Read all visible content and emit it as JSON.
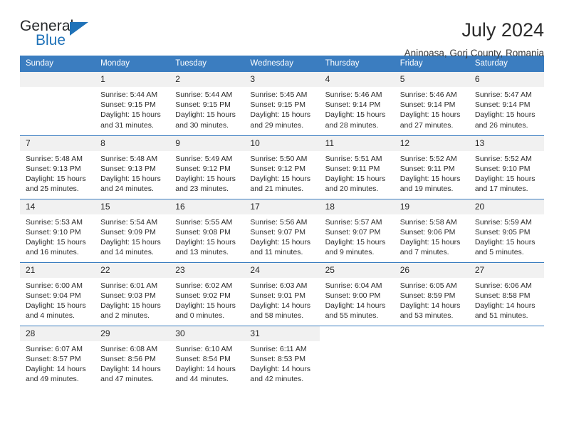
{
  "brand": {
    "word1": "General",
    "word2": "Blue",
    "accent": "#1f72b8",
    "triangle_icon": "triangle-icon"
  },
  "header": {
    "title": "July 2024",
    "subtitle": "Aninoasa, Gorj County, Romania"
  },
  "theme": {
    "header_bg": "#3b7dc0",
    "daynum_bg": "#f1f1f1",
    "text": "#2c2c2c",
    "grid_line": "#3b7dc0"
  },
  "calendar": {
    "weekday_headers": [
      "Sunday",
      "Monday",
      "Tuesday",
      "Wednesday",
      "Thursday",
      "Friday",
      "Saturday"
    ],
    "labels": {
      "sunrise": "Sunrise:",
      "sunset": "Sunset:",
      "daylight": "Daylight:"
    },
    "weeks": [
      [
        {
          "day": "",
          "blank": true,
          "sunrise": "",
          "sunset": "",
          "daylight_1": "",
          "daylight_2": ""
        },
        {
          "day": "1",
          "sunrise": "Sunrise: 5:44 AM",
          "sunset": "Sunset: 9:15 PM",
          "daylight_1": "Daylight: 15 hours",
          "daylight_2": "and 31 minutes."
        },
        {
          "day": "2",
          "sunrise": "Sunrise: 5:44 AM",
          "sunset": "Sunset: 9:15 PM",
          "daylight_1": "Daylight: 15 hours",
          "daylight_2": "and 30 minutes."
        },
        {
          "day": "3",
          "sunrise": "Sunrise: 5:45 AM",
          "sunset": "Sunset: 9:15 PM",
          "daylight_1": "Daylight: 15 hours",
          "daylight_2": "and 29 minutes."
        },
        {
          "day": "4",
          "sunrise": "Sunrise: 5:46 AM",
          "sunset": "Sunset: 9:14 PM",
          "daylight_1": "Daylight: 15 hours",
          "daylight_2": "and 28 minutes."
        },
        {
          "day": "5",
          "sunrise": "Sunrise: 5:46 AM",
          "sunset": "Sunset: 9:14 PM",
          "daylight_1": "Daylight: 15 hours",
          "daylight_2": "and 27 minutes."
        },
        {
          "day": "6",
          "sunrise": "Sunrise: 5:47 AM",
          "sunset": "Sunset: 9:14 PM",
          "daylight_1": "Daylight: 15 hours",
          "daylight_2": "and 26 minutes."
        }
      ],
      [
        {
          "day": "7",
          "sunrise": "Sunrise: 5:48 AM",
          "sunset": "Sunset: 9:13 PM",
          "daylight_1": "Daylight: 15 hours",
          "daylight_2": "and 25 minutes."
        },
        {
          "day": "8",
          "sunrise": "Sunrise: 5:48 AM",
          "sunset": "Sunset: 9:13 PM",
          "daylight_1": "Daylight: 15 hours",
          "daylight_2": "and 24 minutes."
        },
        {
          "day": "9",
          "sunrise": "Sunrise: 5:49 AM",
          "sunset": "Sunset: 9:12 PM",
          "daylight_1": "Daylight: 15 hours",
          "daylight_2": "and 23 minutes."
        },
        {
          "day": "10",
          "sunrise": "Sunrise: 5:50 AM",
          "sunset": "Sunset: 9:12 PM",
          "daylight_1": "Daylight: 15 hours",
          "daylight_2": "and 21 minutes."
        },
        {
          "day": "11",
          "sunrise": "Sunrise: 5:51 AM",
          "sunset": "Sunset: 9:11 PM",
          "daylight_1": "Daylight: 15 hours",
          "daylight_2": "and 20 minutes."
        },
        {
          "day": "12",
          "sunrise": "Sunrise: 5:52 AM",
          "sunset": "Sunset: 9:11 PM",
          "daylight_1": "Daylight: 15 hours",
          "daylight_2": "and 19 minutes."
        },
        {
          "day": "13",
          "sunrise": "Sunrise: 5:52 AM",
          "sunset": "Sunset: 9:10 PM",
          "daylight_1": "Daylight: 15 hours",
          "daylight_2": "and 17 minutes."
        }
      ],
      [
        {
          "day": "14",
          "sunrise": "Sunrise: 5:53 AM",
          "sunset": "Sunset: 9:10 PM",
          "daylight_1": "Daylight: 15 hours",
          "daylight_2": "and 16 minutes."
        },
        {
          "day": "15",
          "sunrise": "Sunrise: 5:54 AM",
          "sunset": "Sunset: 9:09 PM",
          "daylight_1": "Daylight: 15 hours",
          "daylight_2": "and 14 minutes."
        },
        {
          "day": "16",
          "sunrise": "Sunrise: 5:55 AM",
          "sunset": "Sunset: 9:08 PM",
          "daylight_1": "Daylight: 15 hours",
          "daylight_2": "and 13 minutes."
        },
        {
          "day": "17",
          "sunrise": "Sunrise: 5:56 AM",
          "sunset": "Sunset: 9:07 PM",
          "daylight_1": "Daylight: 15 hours",
          "daylight_2": "and 11 minutes."
        },
        {
          "day": "18",
          "sunrise": "Sunrise: 5:57 AM",
          "sunset": "Sunset: 9:07 PM",
          "daylight_1": "Daylight: 15 hours",
          "daylight_2": "and 9 minutes."
        },
        {
          "day": "19",
          "sunrise": "Sunrise: 5:58 AM",
          "sunset": "Sunset: 9:06 PM",
          "daylight_1": "Daylight: 15 hours",
          "daylight_2": "and 7 minutes."
        },
        {
          "day": "20",
          "sunrise": "Sunrise: 5:59 AM",
          "sunset": "Sunset: 9:05 PM",
          "daylight_1": "Daylight: 15 hours",
          "daylight_2": "and 5 minutes."
        }
      ],
      [
        {
          "day": "21",
          "sunrise": "Sunrise: 6:00 AM",
          "sunset": "Sunset: 9:04 PM",
          "daylight_1": "Daylight: 15 hours",
          "daylight_2": "and 4 minutes."
        },
        {
          "day": "22",
          "sunrise": "Sunrise: 6:01 AM",
          "sunset": "Sunset: 9:03 PM",
          "daylight_1": "Daylight: 15 hours",
          "daylight_2": "and 2 minutes."
        },
        {
          "day": "23",
          "sunrise": "Sunrise: 6:02 AM",
          "sunset": "Sunset: 9:02 PM",
          "daylight_1": "Daylight: 15 hours",
          "daylight_2": "and 0 minutes."
        },
        {
          "day": "24",
          "sunrise": "Sunrise: 6:03 AM",
          "sunset": "Sunset: 9:01 PM",
          "daylight_1": "Daylight: 14 hours",
          "daylight_2": "and 58 minutes."
        },
        {
          "day": "25",
          "sunrise": "Sunrise: 6:04 AM",
          "sunset": "Sunset: 9:00 PM",
          "daylight_1": "Daylight: 14 hours",
          "daylight_2": "and 55 minutes."
        },
        {
          "day": "26",
          "sunrise": "Sunrise: 6:05 AM",
          "sunset": "Sunset: 8:59 PM",
          "daylight_1": "Daylight: 14 hours",
          "daylight_2": "and 53 minutes."
        },
        {
          "day": "27",
          "sunrise": "Sunrise: 6:06 AM",
          "sunset": "Sunset: 8:58 PM",
          "daylight_1": "Daylight: 14 hours",
          "daylight_2": "and 51 minutes."
        }
      ],
      [
        {
          "day": "28",
          "sunrise": "Sunrise: 6:07 AM",
          "sunset": "Sunset: 8:57 PM",
          "daylight_1": "Daylight: 14 hours",
          "daylight_2": "and 49 minutes."
        },
        {
          "day": "29",
          "sunrise": "Sunrise: 6:08 AM",
          "sunset": "Sunset: 8:56 PM",
          "daylight_1": "Daylight: 14 hours",
          "daylight_2": "and 47 minutes."
        },
        {
          "day": "30",
          "sunrise": "Sunrise: 6:10 AM",
          "sunset": "Sunset: 8:54 PM",
          "daylight_1": "Daylight: 14 hours",
          "daylight_2": "and 44 minutes."
        },
        {
          "day": "31",
          "sunrise": "Sunrise: 6:11 AM",
          "sunset": "Sunset: 8:53 PM",
          "daylight_1": "Daylight: 14 hours",
          "daylight_2": "and 42 minutes."
        },
        {
          "day": "",
          "outside": true,
          "sunrise": "",
          "sunset": "",
          "daylight_1": "",
          "daylight_2": ""
        },
        {
          "day": "",
          "outside": true,
          "sunrise": "",
          "sunset": "",
          "daylight_1": "",
          "daylight_2": ""
        },
        {
          "day": "",
          "outside": true,
          "sunrise": "",
          "sunset": "",
          "daylight_1": "",
          "daylight_2": ""
        }
      ]
    ]
  }
}
